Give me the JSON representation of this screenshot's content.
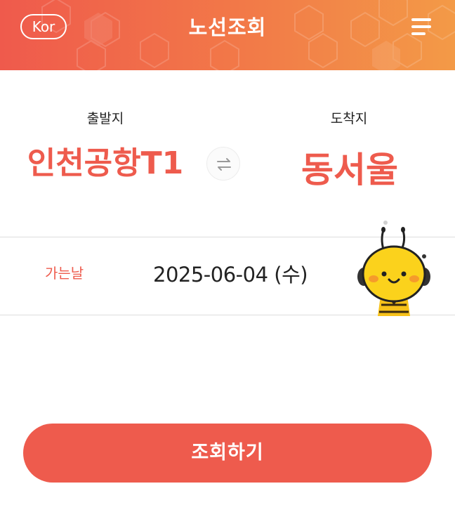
{
  "header": {
    "lang_label": "Kor",
    "title": "노선조회",
    "menu_icon": "hamburger-icon"
  },
  "route": {
    "departure_label": "출발지",
    "departure_value": "인천공항T1",
    "arrival_label": "도착지",
    "arrival_value": "동서울",
    "swap_icon": "swap-arrows-icon"
  },
  "date": {
    "label": "가는날",
    "value": "2025-06-04 (수)"
  },
  "mascot_icon": "bee-mascot-icon",
  "search_button": "조회하기",
  "colors": {
    "accent": "#ee5b4d",
    "header_start": "#ef5a4c",
    "header_end": "#f39a47",
    "divider": "#dddddd"
  }
}
